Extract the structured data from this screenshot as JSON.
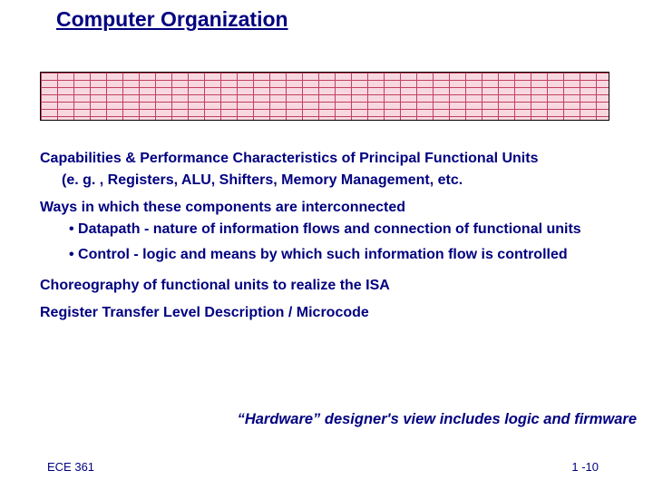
{
  "title": "Computer Organization",
  "section1": {
    "heading": "Capabilities & Performance Characteristics of Principal Functional Units",
    "example": "(e. g. , Registers, ALU, Shifters, Memory Management, etc."
  },
  "section2": {
    "heading": "Ways in which these components are interconnected",
    "bullets": [
      "Datapath - nature of information flows and connection of functional units",
      "Control - logic and means by which such information flow is controlled"
    ]
  },
  "section3": "Choreography of functional units to realize the ISA",
  "section4": "Register Transfer Level Description / Microcode",
  "quote": "“Hardware” designer's view includes logic and firmware",
  "footer": {
    "course": "ECE 361",
    "page": "1 -10"
  }
}
